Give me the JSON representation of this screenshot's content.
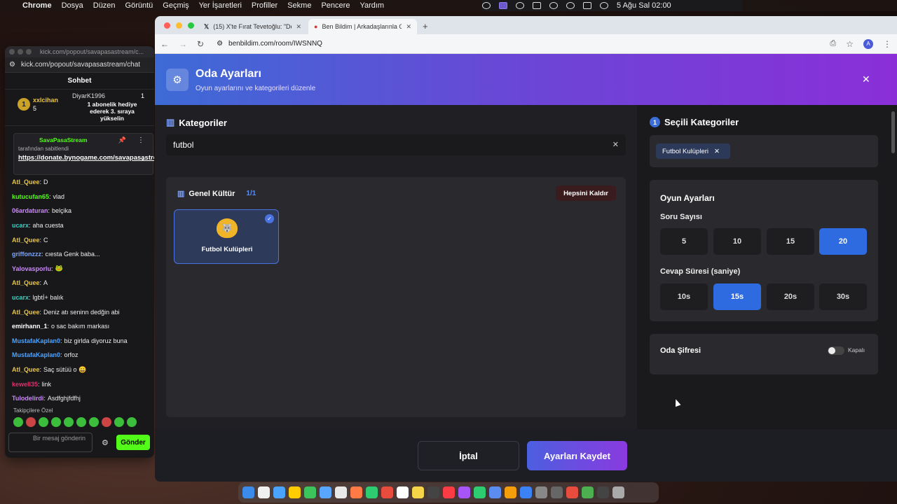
{
  "menubar": {
    "app": "Chrome",
    "items": [
      "Dosya",
      "Düzen",
      "Görüntü",
      "Geçmiş",
      "Yer İşaretleri",
      "Profiller",
      "Sekme",
      "Pencere",
      "Yardım"
    ],
    "clock": "5 Ağu Sal  02:00"
  },
  "chat": {
    "title_url": "kick.com/popout/savapasastream/c...",
    "url": "kick.com/popout/savapasastream/chat",
    "header": "Sohbet",
    "gift": {
      "rank": "1",
      "user1": "xxlcihan",
      "count1": "5",
      "user2": "DiyarK1996",
      "count2": "1",
      "message": "1 abonelik hediye ederek 3. sıraya yükselin"
    },
    "pinned": {
      "user": "SavaPasaStream",
      "sub": "tarafından sabitlendi",
      "link": "https://donate.bynogame.com/savapasastream"
    },
    "messages": [
      {
        "user": "Atl_Quee",
        "text": "D",
        "color": "#e8c547"
      },
      {
        "user": "kutucufan65",
        "text": "vlad",
        "color": "#53fc18"
      },
      {
        "user": "06ardaturan",
        "text": "belçika",
        "color": "#c98af5"
      },
      {
        "user": "ucarx",
        "text": "aha cuesta",
        "color": "#2ed3c5"
      },
      {
        "user": "Atl_Quee",
        "text": "C",
        "color": "#e8c547"
      },
      {
        "user": "griffonzzz",
        "text": "cıesta Genk baba...",
        "color": "#7aa6ff"
      },
      {
        "user": "Yalovasporlu",
        "text": "🐸",
        "color": "#c98af5"
      },
      {
        "user": "Atl_Quee",
        "text": "A",
        "color": "#e8c547"
      },
      {
        "user": "ucarx",
        "text": "lgbtİ+ balık",
        "color": "#2ed3c5"
      },
      {
        "user": "Atl_Quee",
        "text": "Deniz atı seninn dedğin abi",
        "color": "#e8c547"
      },
      {
        "user": "emirhann_1",
        "text": "o sac bakım markası",
        "color": "#ffffff"
      },
      {
        "user": "MustafaKaplan0",
        "text": "biz girlda diyoruz buna",
        "color": "#4aa3ff"
      },
      {
        "user": "MustafaKaplan0",
        "text": "orfoz",
        "color": "#4aa3ff"
      },
      {
        "user": "Atl_Quee",
        "text": "Saç sütüü o 😄",
        "color": "#e8c547"
      },
      {
        "user": "kewell35",
        "text": "link",
        "color": "#e0306a"
      },
      {
        "user": "Tulodelirdi",
        "text": "Asdfghjfdfhj",
        "color": "#c98af5"
      }
    ],
    "followers_only": "Takipçilere Özel",
    "input_placeholder": "Bir mesaj gönderin",
    "send": "Gönder"
  },
  "browser": {
    "tabs": [
      {
        "title": "(15) X'te Fırat Tevetoğlu: \"De..."
      },
      {
        "title": "Ben Bildim | Arkadaşlarınla Oy..."
      }
    ],
    "url": "benbildim.com/room/IWSNNQ",
    "avatar": "A"
  },
  "modal": {
    "title": "Oda Ayarları",
    "subtitle": "Oyun ayarlarını ve kategorileri düzenle",
    "categories_title": "Kategoriler",
    "search_value": "futbol",
    "group": {
      "name": "Genel Kültür",
      "count": "1/1",
      "remove_all": "Hepsini Kaldır"
    },
    "card": {
      "label": "Futbol Kulüpleri"
    },
    "selected_step": "1",
    "selected_title": "Seçili Kategoriler",
    "selected_chip": "Futbol Kulüpleri",
    "game_settings_title": "Oyun Ayarları",
    "question_count_label": "Soru Sayısı",
    "question_counts": [
      "5",
      "10",
      "15",
      "20"
    ],
    "question_selected": "20",
    "answer_time_label": "Cevap Süresi (saniye)",
    "answer_times": [
      "10s",
      "15s",
      "20s",
      "30s"
    ],
    "answer_selected": "15s",
    "password_label": "Oda Şifresi",
    "password_state": "Kapalı",
    "cancel": "İptal",
    "save": "Ayarları Kaydet"
  }
}
